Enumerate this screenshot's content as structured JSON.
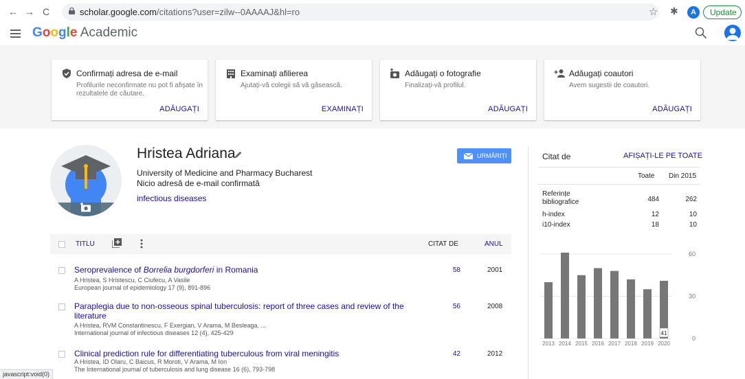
{
  "browser": {
    "url_host": "scholar.google.com",
    "url_path": "/citations?user=zilw--0AAAAJ&hl=ro",
    "profile_letter": "A",
    "update_label": "Update"
  },
  "header": {
    "logo_google": "Google",
    "logo_suffix": "Academic"
  },
  "banner": {
    "cards": [
      {
        "title": "Confirmați adresa de e-mail",
        "desc": "Profilurile neconfirmate nu pot fi afișate în rezultatele de căutare.",
        "action": "ADĂUGAȚI"
      },
      {
        "title": "Examinați afilierea",
        "desc": "Ajutați-vă colegii să vă găsească.",
        "action": "EXAMINAȚI"
      },
      {
        "title": "Adăugați o fotografie",
        "desc": "Finalizați-vă profilul.",
        "action": "ADĂUGAȚI"
      },
      {
        "title": "Adăugați coautori",
        "desc": "Avem sugestii de coautori.",
        "action": "ADĂUGAȚI"
      }
    ]
  },
  "profile": {
    "name": "Hristea Adriana",
    "affiliation": "University of Medicine and Pharmacy Bucharest",
    "email_status": "Nicio adresă de e-mail confirmată",
    "interest": "infectious diseases",
    "follow_label": "URMĂRIȚI"
  },
  "table": {
    "col_title": "TITLU",
    "col_cited": "CITAT DE",
    "col_year": "ANUL",
    "articles": [
      {
        "title_pre": "Seroprevalence of ",
        "title_em": "Borrelia burgdorferi",
        "title_post": " in Romania",
        "authors": "A Hristea, S Hristescu, C Ciufecu, A Vasile",
        "journal": "European journal of epidemiology 17 (9), 891-896",
        "cited": "58",
        "year": "2001"
      },
      {
        "title": "Paraplegia due to non-osseous spinal tuberculosis: report of three cases and review of the literature",
        "authors": "A Hristea, RVM Constantinescu, F Exergian, V Arama, M Besleaga, ...",
        "journal": "International journal of infectious diseases 12 (4), 425-429",
        "cited": "56",
        "year": "2008"
      },
      {
        "title": "Clinical prediction rule for differentiating tuberculous from viral meningitis",
        "authors": "A Hristea, ID Olaru, C Baicus, R Moroti, V Arama, M Ion",
        "journal": "The International journal of tuberculosis and lung disease 16 (6), 793-798",
        "cited": "42",
        "year": "2012"
      }
    ]
  },
  "cited_by": {
    "title": "Citat de",
    "view_all": "AFIȘAȚI-LE PE TOATE",
    "col_all": "Toate",
    "col_since": "Din 2015",
    "rows": [
      {
        "label": "Referințe bibliografice",
        "all": "484",
        "since": "262"
      },
      {
        "label": "h-index",
        "all": "12",
        "since": "10"
      },
      {
        "label": "i10-index",
        "all": "18",
        "since": "10"
      }
    ]
  },
  "chart_data": {
    "type": "bar",
    "categories": [
      "2013",
      "2014",
      "2015",
      "2016",
      "2017",
      "2018",
      "2019",
      "2020"
    ],
    "values": [
      40,
      61,
      45,
      50,
      48,
      42,
      35,
      41
    ],
    "ylim": [
      0,
      60
    ],
    "yticks": [
      "60",
      "30",
      "0"
    ],
    "highlight_label": "41",
    "grid": true,
    "bar_color": "#777777"
  },
  "status_bar": "javascript:void(0)"
}
